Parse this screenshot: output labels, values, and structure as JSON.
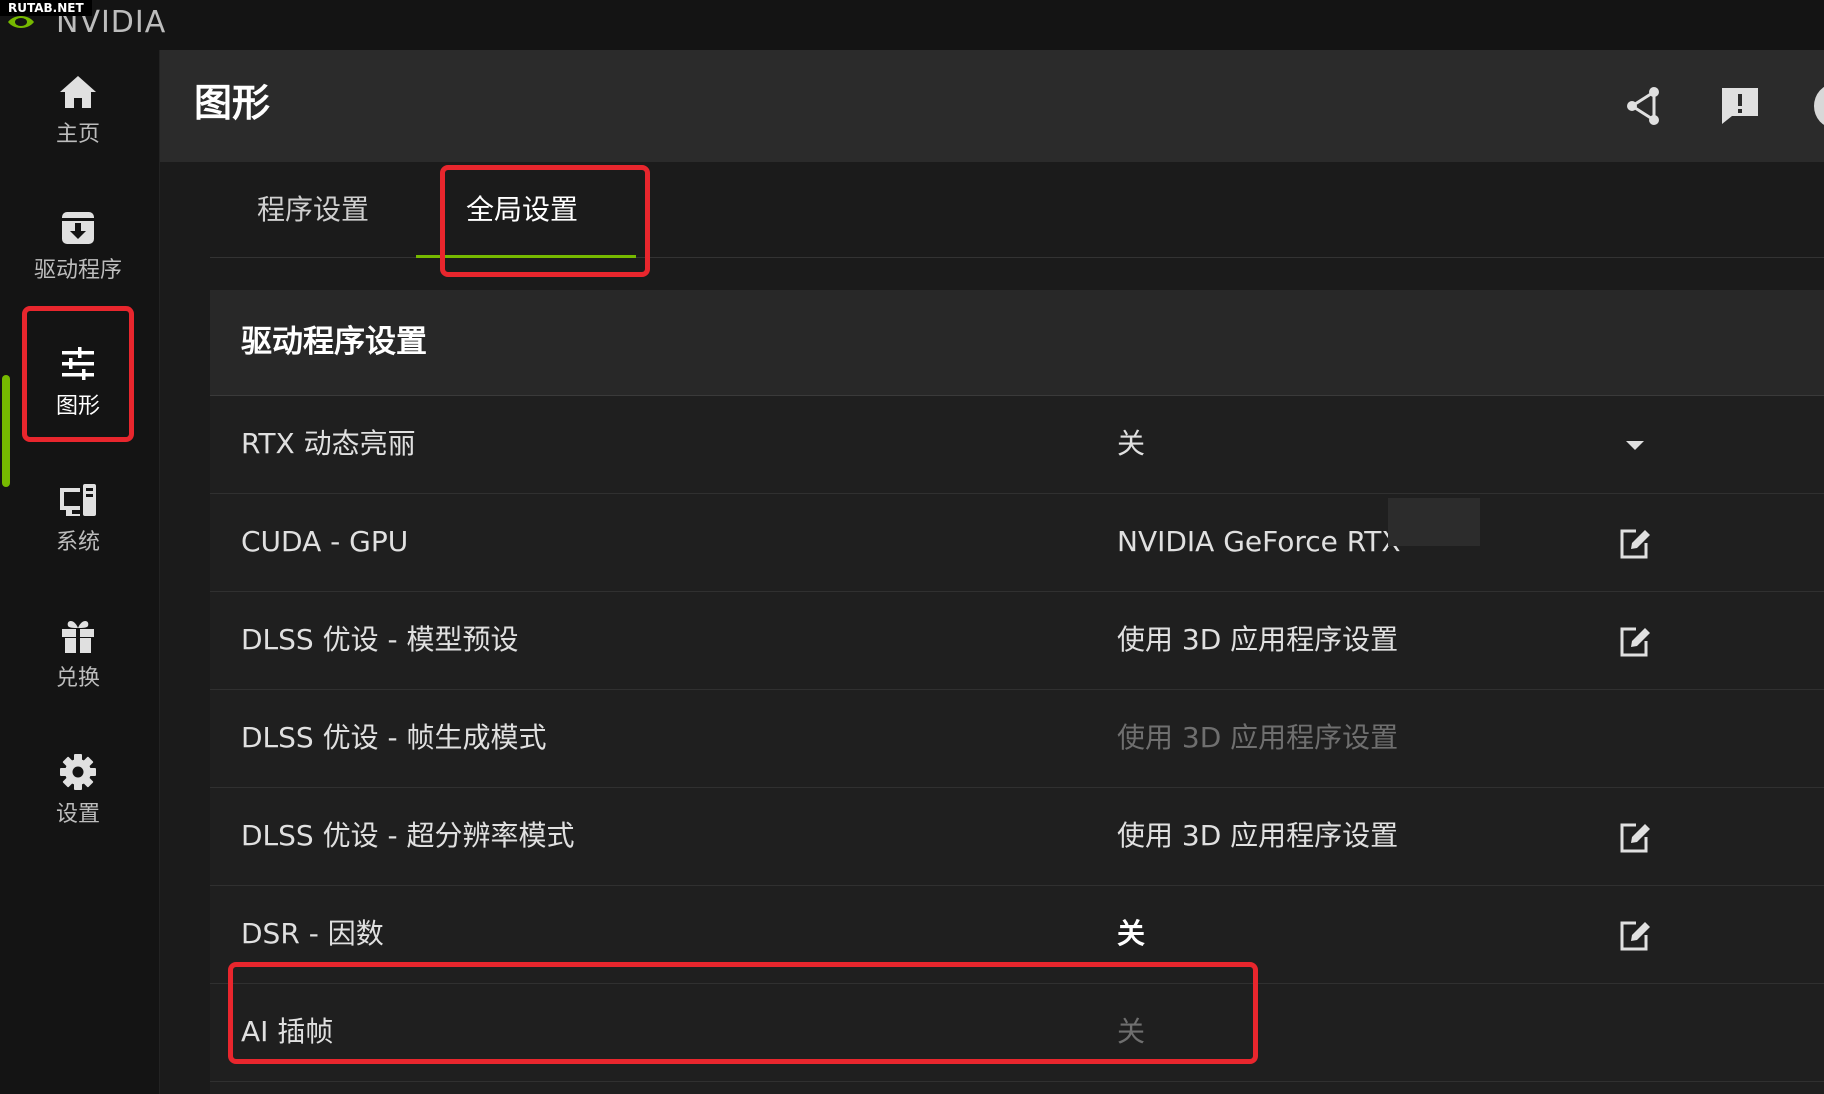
{
  "watermark": "RUTAB.NET",
  "brand": {
    "name": "NVIDIA"
  },
  "sidebar": {
    "items": [
      {
        "id": "home",
        "label": "主页",
        "icon": "home-icon"
      },
      {
        "id": "drivers",
        "label": "驱动程序",
        "icon": "download-icon"
      },
      {
        "id": "graphics",
        "label": "图形",
        "icon": "sliders-icon",
        "active": true
      },
      {
        "id": "system",
        "label": "系统",
        "icon": "monitor-icon"
      },
      {
        "id": "redeem",
        "label": "兑换",
        "icon": "gift-icon"
      },
      {
        "id": "settings",
        "label": "设置",
        "icon": "gear-icon"
      }
    ]
  },
  "header": {
    "title": "图形",
    "icons": [
      "share-icon",
      "feedback-icon"
    ]
  },
  "tabs": [
    {
      "label": "程序设置",
      "active": false
    },
    {
      "label": "全局设置",
      "active": true
    }
  ],
  "section": {
    "title": "驱动程序设置",
    "rows": [
      {
        "label": "RTX 动态亮丽",
        "value": "关",
        "action": "dropdown",
        "style": "normal"
      },
      {
        "label": "CUDA - GPU",
        "value": "NVIDIA GeForce RTX",
        "action": "edit",
        "style": "normal"
      },
      {
        "label": "DLSS 优设 - 模型预设",
        "value": "使用 3D 应用程序设置",
        "action": "edit",
        "style": "normal"
      },
      {
        "label": "DLSS 优设 - 帧生成模式",
        "value": "使用 3D 应用程序设置",
        "action": "none",
        "style": "dim"
      },
      {
        "label": "DLSS 优设 - 超分辨率模式",
        "value": "使用 3D 应用程序设置",
        "action": "edit",
        "style": "normal"
      },
      {
        "label": "DSR - 因数",
        "value": "关",
        "action": "edit",
        "style": "bold"
      },
      {
        "label": "AI 插帧",
        "value": "关",
        "action": "none",
        "style": "dim"
      }
    ]
  },
  "colors": {
    "accent": "#76b900",
    "highlight": "#e8262d",
    "background": "#1b1b1b",
    "header": "#2b2b2b"
  }
}
